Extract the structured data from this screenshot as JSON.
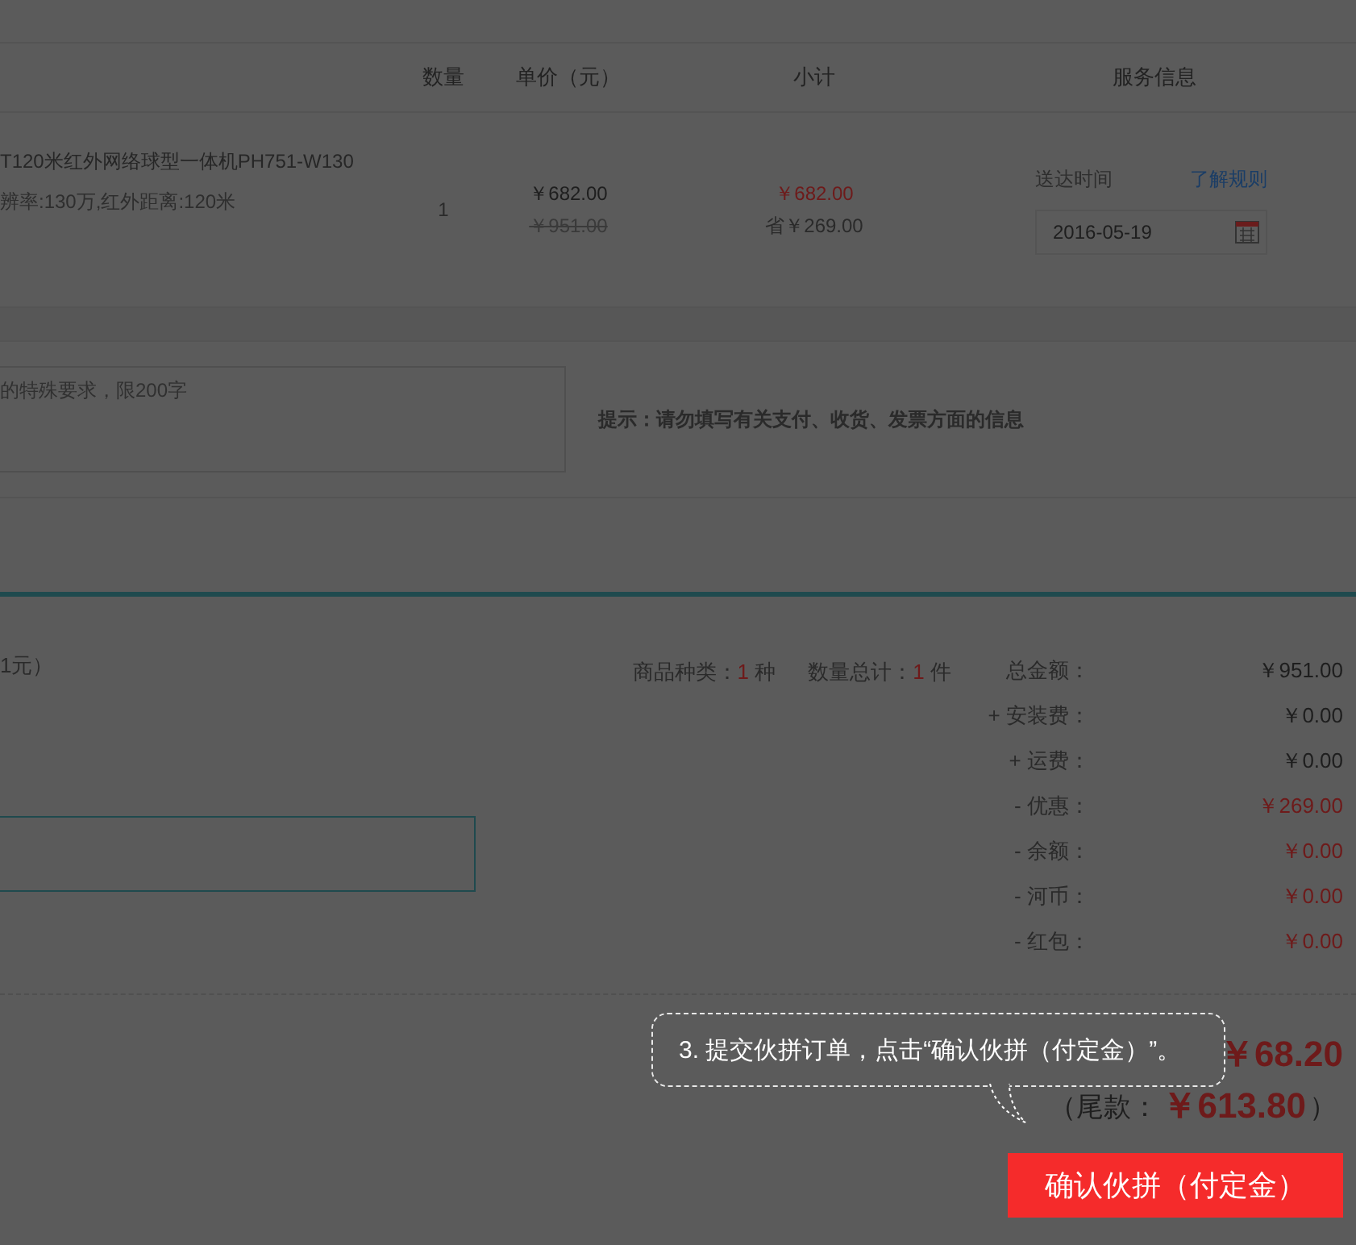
{
  "table": {
    "columns": [
      "数量",
      "单价（元）",
      "小计",
      "服务信息"
    ],
    "rows": [
      {
        "product_name": "T120米红外网络球型一体机PH751-W130",
        "product_spec": "辨率:130万,红外距离:120米",
        "quantity": "1",
        "price": "￥682.00",
        "original_price": "￥951.00",
        "subtotal": "￥682.00",
        "savings": "省￥269.00",
        "delivery_label": "送达时间",
        "rules_link": "了解规则",
        "delivery_date": "2016-05-19"
      }
    ]
  },
  "remarks": {
    "placeholder": "的特殊要求，限200字",
    "hint": "提示：请勿填写有关支付、收货、发票方面的信息"
  },
  "summary": {
    "note": "1元）",
    "counts": [
      {
        "label": "商品种类：",
        "value": "1",
        "unit": "种"
      },
      {
        "label": "数量总计：",
        "value": "1",
        "unit": "件"
      }
    ],
    "fees": [
      {
        "label": "总金额：",
        "amount": "￥951.00",
        "kind": "charge"
      },
      {
        "label": "+ 安装费：",
        "amount": "￥0.00",
        "kind": "charge"
      },
      {
        "label": "+ 运费：",
        "amount": "￥0.00",
        "kind": "charge"
      },
      {
        "label": "- 优惠：",
        "amount": "￥269.00",
        "kind": "deduction"
      },
      {
        "label": "- 余额：",
        "amount": "￥0.00",
        "kind": "deduction"
      },
      {
        "label": "- 河币：",
        "amount": "￥0.00",
        "kind": "deduction"
      },
      {
        "label": "- 红包：",
        "amount": "￥0.00",
        "kind": "deduction"
      }
    ]
  },
  "deposit": {
    "amount": "￥68.20",
    "balance_open": "（尾款：",
    "balance": "￥613.80",
    "balance_close": "）"
  },
  "tooltip": {
    "text": "3. 提交伙拼订单，点击“确认伙拼（付定金）”。"
  },
  "submit_button": "确认伙拼（付定金）"
}
